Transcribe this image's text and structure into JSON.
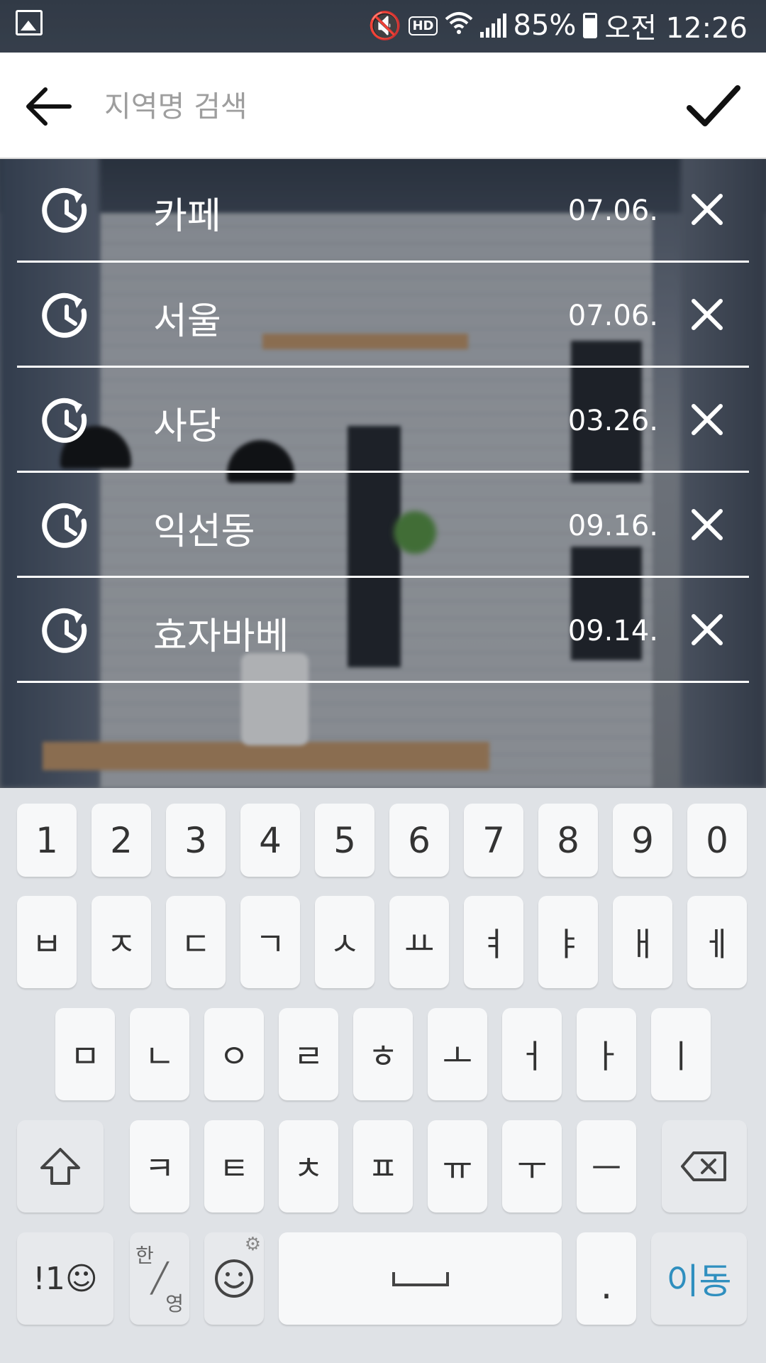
{
  "status_bar": {
    "battery": "85%",
    "time": "오전 12:26",
    "hd_label": "HD"
  },
  "search": {
    "placeholder": "지역명 검색",
    "value": ""
  },
  "recent_searches": [
    {
      "term": "카페",
      "date": "07.06."
    },
    {
      "term": "서울",
      "date": "07.06."
    },
    {
      "term": "사당",
      "date": "03.26."
    },
    {
      "term": "익선동",
      "date": "09.16."
    },
    {
      "term": "효자바베",
      "date": "09.14."
    }
  ],
  "keyboard": {
    "numbers": [
      "1",
      "2",
      "3",
      "4",
      "5",
      "6",
      "7",
      "8",
      "9",
      "0"
    ],
    "row1": [
      "ㅂ",
      "ㅈ",
      "ㄷ",
      "ㄱ",
      "ㅅ",
      "ㅛ",
      "ㅕ",
      "ㅑ",
      "ㅐ",
      "ㅔ"
    ],
    "row2": [
      "ㅁ",
      "ㄴ",
      "ㅇ",
      "ㄹ",
      "ㅎ",
      "ㅗ",
      "ㅓ",
      "ㅏ",
      "ㅣ"
    ],
    "row3": [
      "ㅋ",
      "ㅌ",
      "ㅊ",
      "ㅍ",
      "ㅠ",
      "ㅜ",
      "ㅡ"
    ],
    "symbols_label": "!1☺",
    "lang_top": "한",
    "lang_bottom": "영",
    "period": ".",
    "go_label": "이동"
  }
}
